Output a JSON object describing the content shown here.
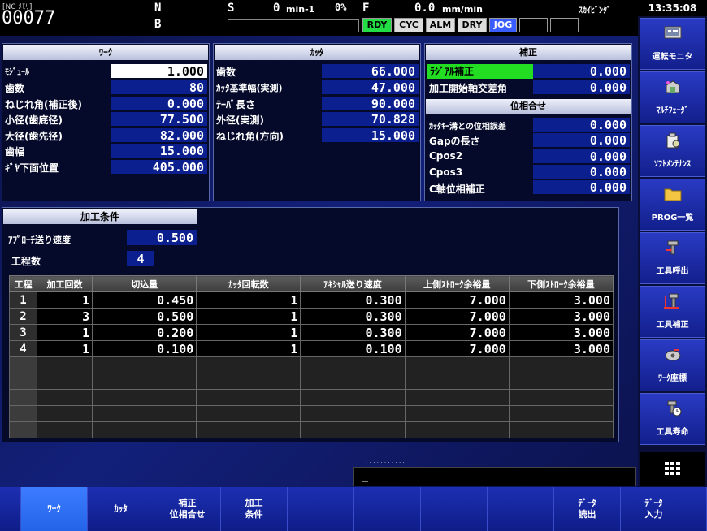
{
  "header": {
    "mem_label": "[NC ﾒﾓﾘ]",
    "program_no": "00077",
    "n": "N",
    "b": "B",
    "s_label": "S",
    "s_value": "0",
    "s_unit": "min-1",
    "pct": "0%",
    "f_label": "F",
    "f_value": "0.0",
    "f_unit": "mm/min",
    "skiving": "ｽｶｲﾋﾞﾝｸﾞ",
    "status": [
      "RDY",
      "CYC",
      "ALM",
      "DRY",
      "JOG"
    ],
    "active_color": "#22dd44",
    "jog_color": "#3a5dff"
  },
  "work": {
    "title": "ﾜｰｸ",
    "rows": [
      {
        "label": "ﾓｼﾞｭｰﾙ",
        "value": "1.000"
      },
      {
        "label": "歯数",
        "value": "80"
      },
      {
        "label": "ねじれ角(補正後)",
        "value": "0.000"
      },
      {
        "label": "小径(歯底径)",
        "value": "77.500"
      },
      {
        "label": "大径(歯先径)",
        "value": "82.000"
      },
      {
        "label": "歯幅",
        "value": "15.000"
      },
      {
        "label": "ｷﾞﾔ下面位置",
        "value": "405.000"
      }
    ]
  },
  "cutter": {
    "title": "ｶｯﾀ",
    "rows": [
      {
        "label": "歯数",
        "value": "66.000"
      },
      {
        "label": "ｶｯﾀ基準幅(実測)",
        "value": "47.000"
      },
      {
        "label": "ﾃｰﾊﾟ長さ",
        "value": "90.000"
      },
      {
        "label": "外径(実測)",
        "value": "70.828"
      },
      {
        "label": "ねじれ角(方向)",
        "value": "15.000"
      }
    ]
  },
  "correction": {
    "title": "補正",
    "rows": [
      {
        "label": "ﾗｼﾞｱﾙ補正",
        "value": "0.000"
      },
      {
        "label": "加工開始軸交差角",
        "value": "0.000"
      }
    ]
  },
  "phase": {
    "title": "位相合せ",
    "rows": [
      {
        "label": "ｶｯﾀｷｰ溝との位相誤差",
        "value": "0.000"
      },
      {
        "label": "Gapの長さ",
        "value": "0.000"
      },
      {
        "label": "Cpos2",
        "value": "0.000"
      },
      {
        "label": "Cpos3",
        "value": "0.000"
      },
      {
        "label": "C軸位相補正",
        "value": "0.000"
      }
    ]
  },
  "conditions": {
    "title": "加工条件",
    "approach_label": "ｱﾌﾟﾛｰﾁ送り速度",
    "approach_value": "0.500",
    "steps_label": "工程数",
    "steps_value": "4",
    "columns": [
      "工程",
      "加工回数",
      "切込量",
      "ｶｯﾀ回転数",
      "ｱｷｼｬﾙ送り速度",
      "上側ｽﾄﾛｰｸ余裕量",
      "下側ｽﾄﾛｰｸ余裕量"
    ],
    "rows": [
      [
        "1",
        "1",
        "0.450",
        "1",
        "0.300",
        "7.000",
        "3.000"
      ],
      [
        "2",
        "3",
        "0.500",
        "1",
        "0.300",
        "7.000",
        "3.000"
      ],
      [
        "3",
        "1",
        "0.200",
        "1",
        "0.300",
        "7.000",
        "3.000"
      ],
      [
        "4",
        "1",
        "0.100",
        "1",
        "0.100",
        "7.000",
        "3.000"
      ]
    ]
  },
  "side": {
    "clock": "13:35:08",
    "buttons": [
      {
        "label": "運転モニタ",
        "icon": "monitor-icon"
      },
      {
        "label": "ﾏﾙﾁﾌｪｰﾀﾞ",
        "icon": "multi-feeder-icon"
      },
      {
        "label": "ｿﾌﾄﾒﾝﾃﾅﾝｽ",
        "icon": "maintenance-icon"
      },
      {
        "label": "PROG一覧",
        "icon": "folder-icon"
      },
      {
        "label": "工具呼出",
        "icon": "tool-call-icon"
      },
      {
        "label": "工具補正",
        "icon": "tool-correction-icon"
      },
      {
        "label": "ﾜｰｸ座標",
        "icon": "work-coordinate-icon"
      },
      {
        "label": "工具寿命",
        "icon": "tool-life-icon"
      }
    ]
  },
  "command": {
    "cursor": "_",
    "dots": "..........."
  },
  "fkeys": [
    "ﾜｰｸ",
    "ｶｯﾀ",
    "補正\n位相合せ",
    "加工\n条件",
    "",
    "",
    "",
    "",
    "ﾃﾞｰﾀ\n読出",
    "ﾃﾞｰﾀ\n入力",
    ""
  ]
}
